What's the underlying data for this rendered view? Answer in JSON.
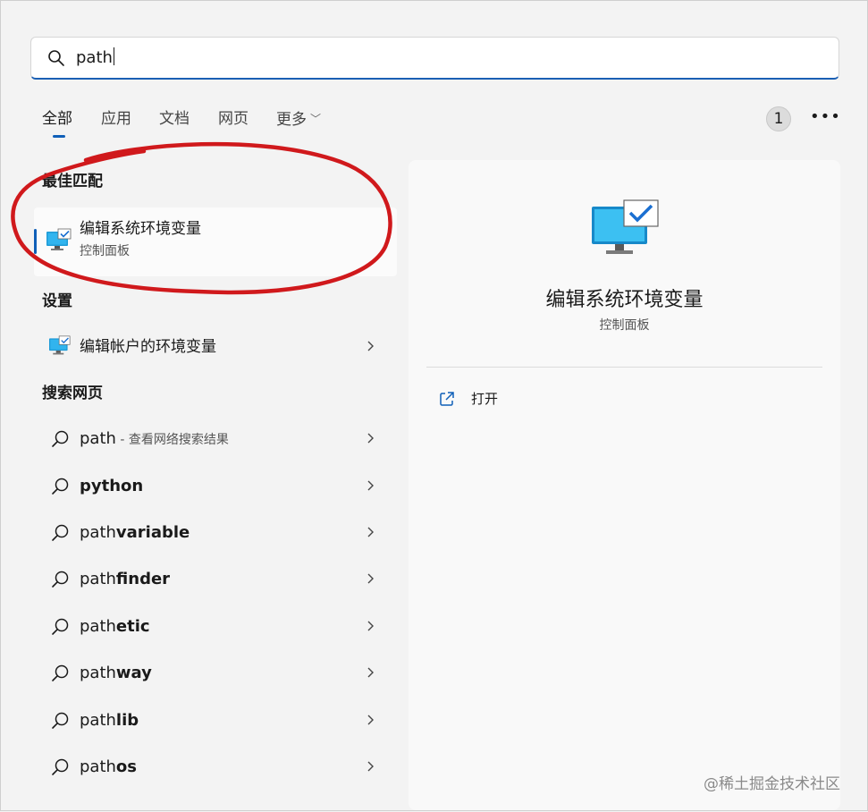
{
  "search": {
    "value": "path"
  },
  "tabs": [
    {
      "label": "全部"
    },
    {
      "label": "应用"
    },
    {
      "label": "文档"
    },
    {
      "label": "网页"
    },
    {
      "label": "更多"
    }
  ],
  "header_badge": "1",
  "sections": {
    "best_match": "最佳匹配",
    "settings": "设置",
    "web": "搜索网页"
  },
  "best_match": {
    "title": "编辑系统环境变量",
    "subtitle": "控制面板"
  },
  "settings_items": [
    {
      "label": "编辑帐户的环境变量"
    }
  ],
  "web_results": [
    {
      "prefix": "path",
      "suffix": "",
      "hint": " - 查看网络搜索结果"
    },
    {
      "prefix": "",
      "suffix": "python",
      "hint": ""
    },
    {
      "prefix": "path",
      "suffix": "variable",
      "hint": ""
    },
    {
      "prefix": "path",
      "suffix": "finder",
      "hint": ""
    },
    {
      "prefix": "path",
      "suffix": "etic",
      "hint": ""
    },
    {
      "prefix": "path",
      "suffix": "way",
      "hint": ""
    },
    {
      "prefix": "path",
      "suffix": "lib",
      "hint": ""
    },
    {
      "prefix": "path",
      "suffix": "os",
      "hint": ""
    }
  ],
  "detail": {
    "title": "编辑系统环境变量",
    "subtitle": "控制面板",
    "action_label": "打开"
  },
  "watermark": "@稀土掘金技术社区",
  "colors": {
    "accent": "#0f5fb8",
    "annotation": "#d0191c",
    "monitor": "#1e9bd7"
  }
}
